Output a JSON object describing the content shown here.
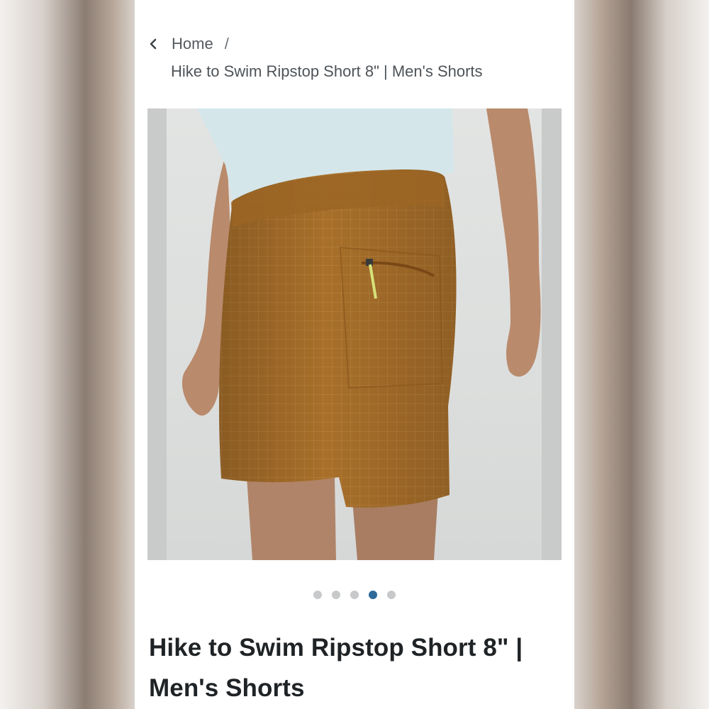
{
  "breadcrumb": {
    "home_label": "Home",
    "separator": "/",
    "current": "Hike to Swim Ripstop Short 8\" | Men's Shorts"
  },
  "carousel": {
    "slide_count": 5,
    "active_index": 3,
    "active_color": "#2f6b9a",
    "inactive_color": "#c7c9cb"
  },
  "product": {
    "title": "Hike to Swim Ripstop Short 8\" | Men's Shorts",
    "image_subject": "man wearing brown ripstop shorts and light blue shirt"
  },
  "colors": {
    "shorts": "#a86f2a",
    "shirt": "#d4e6ea",
    "skin": "#b98a6c",
    "zipper_pull": "#d6e27a"
  },
  "icons": {
    "back": "chevron-left-icon"
  }
}
